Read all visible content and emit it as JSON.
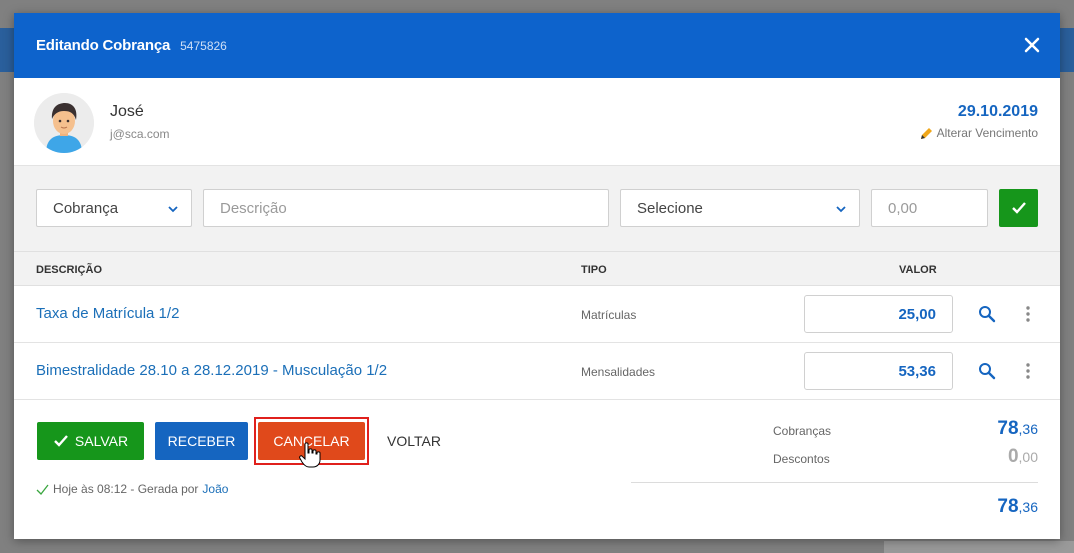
{
  "modal": {
    "title": "Editando Cobrança",
    "record_id": "5475826"
  },
  "client": {
    "name": "José",
    "email": "j@sca.com",
    "due_date": "29.10.2019",
    "change_due_label": "Alterar Vencimento"
  },
  "form": {
    "type_value": "Cobrança",
    "description_placeholder": "Descrição",
    "category_value": "Selecione",
    "amount_placeholder": "0,00"
  },
  "table": {
    "headers": {
      "description": "DESCRIÇÃO",
      "type": "TIPO",
      "value": "VALOR"
    },
    "rows": [
      {
        "description": "Taxa de Matrícula 1/2",
        "type": "Matrículas",
        "value": "25,00"
      },
      {
        "description": "Bimestralidade 28.10 a 28.12.2019 - Musculação 1/2",
        "type": "Mensalidades",
        "value": "53,36"
      }
    ]
  },
  "actions": {
    "save": "SALVAR",
    "receive": "RECEBER",
    "cancel": "CANCELAR",
    "back": "VOLTAR"
  },
  "history": {
    "text": "Hoje às 08:12 - Gerada por",
    "author": "João"
  },
  "totals": {
    "charges_label": "Cobranças",
    "charges_int": "78",
    "charges_dec": ",36",
    "discounts_label": "Descontos",
    "discounts_int": "0",
    "discounts_dec": ",00",
    "total_int": "78",
    "total_dec": ",36"
  },
  "colors": {
    "header_blue": "#0d63cc",
    "save_green": "#16961b",
    "receive_blue": "#1565c0",
    "cancel_orange": "#e0491b",
    "highlight_red": "#e0201c"
  }
}
